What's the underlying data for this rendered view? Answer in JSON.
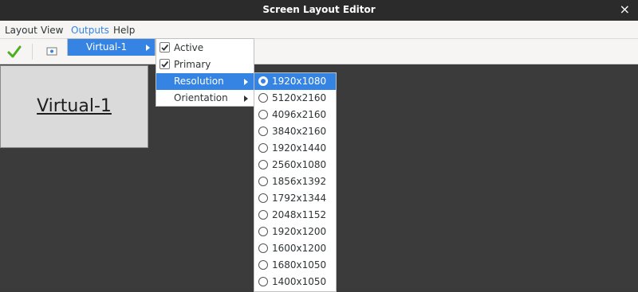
{
  "window": {
    "title": "Screen Layout Editor",
    "close_glyph": "×"
  },
  "menubar": {
    "items": [
      "Layout",
      "View",
      "Outputs",
      "Help"
    ],
    "active": "Outputs"
  },
  "toolbar": {
    "apply_icon": "checkmark-icon",
    "config_icon": "display-settings-icon"
  },
  "monitor": {
    "label": "Virtual-1"
  },
  "outputs_menu": {
    "items": [
      {
        "label": "Virtual-1",
        "has_submenu": true,
        "selected": true
      }
    ]
  },
  "output_submenu": {
    "active_label": "Active",
    "active_checked": true,
    "primary_label": "Primary",
    "primary_checked": true,
    "resolution_label": "Resolution",
    "orientation_label": "Orientation"
  },
  "resolutions": {
    "selected": "1920x1080",
    "items": [
      "1920x1080",
      "5120x2160",
      "4096x2160",
      "3840x2160",
      "1920x1440",
      "2560x1080",
      "1856x1392",
      "1792x1344",
      "2048x1152",
      "1920x1200",
      "1600x1200",
      "1680x1050",
      "1400x1050"
    ]
  },
  "colors": {
    "accent": "#3584e4",
    "titlebar": "#2b2b2b",
    "canvas": "#3b3b3b",
    "apply_green": "#4caf1e"
  }
}
